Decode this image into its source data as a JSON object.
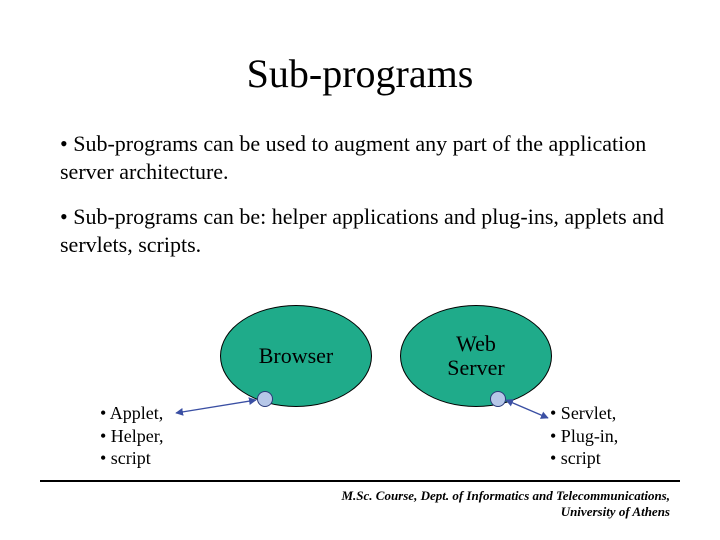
{
  "title": "Sub-programs",
  "bullets": [
    "• Sub-programs can be used to augment any part of the application server architecture.",
    "• Sub-programs can be: helper applications and plug-ins, applets and servlets, scripts."
  ],
  "nodes": {
    "browser": "Browser",
    "web_server": "Web\nServer"
  },
  "left_items": [
    "• Applet,",
    "• Helper,",
    "• script"
  ],
  "right_items": [
    "• Servlet,",
    "• Plug-in,",
    "• script"
  ],
  "footer": {
    "line1": "M.Sc. Course, Dept. of Informatics and Telecommunications,",
    "line2": "University of Athens"
  },
  "colors": {
    "node_fill": "#1fab8a",
    "arrow": "#3a4fa3",
    "attach_dot_fill": "#b6c7e8",
    "attach_dot_stroke": "#2a3a7a"
  }
}
